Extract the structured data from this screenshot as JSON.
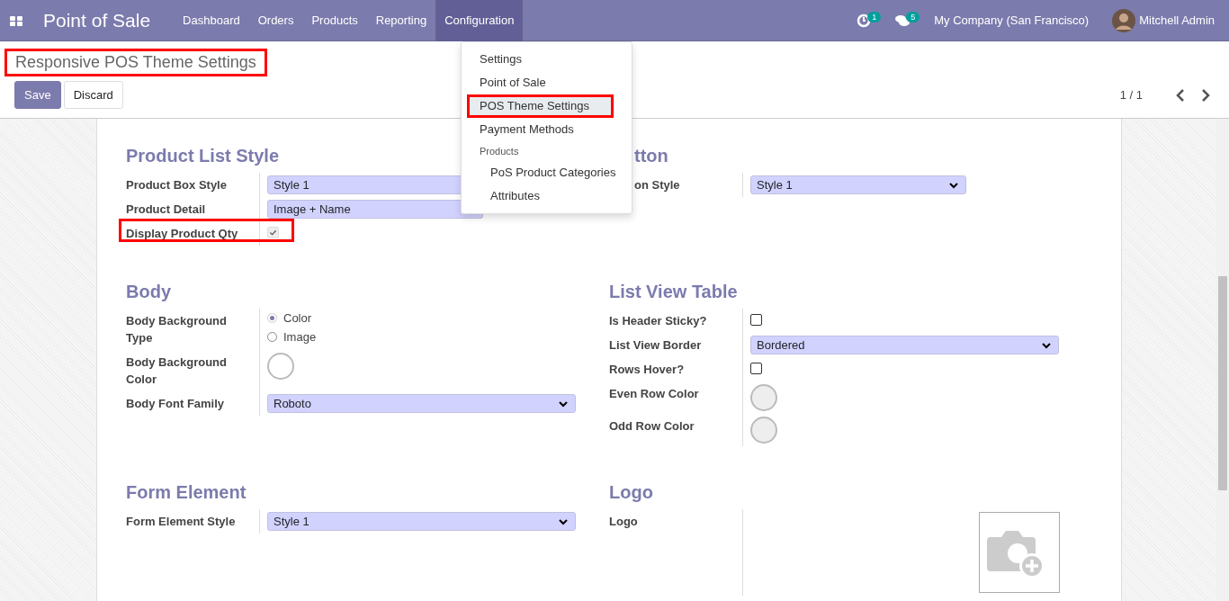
{
  "navbar": {
    "app_title": "Point of Sale",
    "menu": [
      {
        "label": "Dashboard",
        "selected": false
      },
      {
        "label": "Orders",
        "selected": false
      },
      {
        "label": "Products",
        "selected": false
      },
      {
        "label": "Reporting",
        "selected": false
      },
      {
        "label": "Configuration",
        "selected": true
      }
    ],
    "activity_count": "1",
    "message_count": "5",
    "company": "My Company (San Francisco)",
    "user": "Mitchell Admin"
  },
  "control_panel": {
    "title": "Responsive POS Theme Settings",
    "title_highlighted": true,
    "buttons": [
      {
        "label": "Save",
        "kind": "primary"
      },
      {
        "label": "Discard",
        "kind": "secondary"
      }
    ],
    "pager": "1 / 1"
  },
  "dropdown": {
    "items": [
      {
        "label": "Settings",
        "kind": "item",
        "selected": false,
        "highlighted": false
      },
      {
        "label": "Point of Sale",
        "kind": "item",
        "selected": false,
        "highlighted": false
      },
      {
        "label": "POS Theme Settings",
        "kind": "item",
        "selected": true,
        "highlighted": true
      },
      {
        "label": "Payment Methods",
        "kind": "item",
        "selected": false,
        "highlighted": false
      },
      {
        "label": "Products",
        "kind": "header"
      },
      {
        "label": "PoS Product Categories",
        "kind": "subitem",
        "selected": false,
        "highlighted": false
      },
      {
        "label": "Attributes",
        "kind": "subitem",
        "selected": false,
        "highlighted": false
      }
    ]
  },
  "sections": [
    {
      "title": "Product List Style",
      "covered": false,
      "fields": [
        {
          "label": "Product Box Style",
          "kind": "select",
          "value": "Style 1",
          "wide": false
        },
        {
          "label": "Product Detail",
          "kind": "select",
          "value": "Image + Name",
          "wide": false
        },
        {
          "label": "Display Product Qty",
          "kind": "checkbox",
          "checked": true,
          "highlighted": true
        }
      ]
    },
    {
      "title": "tton",
      "covered": true,
      "fields": [
        {
          "label": "on Style",
          "kind": "select",
          "value": "Style 1",
          "wide": false
        }
      ]
    },
    {
      "title": "Body",
      "covered": false,
      "fields": [
        {
          "label": "Body Background Type",
          "kind": "radio",
          "options": [
            {
              "label": "Color",
              "selected": true
            },
            {
              "label": "Image",
              "selected": false
            }
          ]
        },
        {
          "label": "Body Background Color",
          "kind": "color",
          "color": "#ffffff"
        },
        {
          "label": "Body Font Family",
          "kind": "select",
          "value": "Roboto",
          "wide": true
        }
      ]
    },
    {
      "title": "List View Table",
      "covered": false,
      "fields": [
        {
          "label": "Is Header Sticky?",
          "kind": "checkbox",
          "checked": false,
          "highlighted": false
        },
        {
          "label": "List View Border",
          "kind": "select",
          "value": "Bordered",
          "wide": true
        },
        {
          "label": "Rows Hover?",
          "kind": "checkbox",
          "checked": false,
          "highlighted": false
        },
        {
          "label": "Even Row Color",
          "kind": "color",
          "color": "#eeeeee"
        },
        {
          "label": "Odd Row Color",
          "kind": "color",
          "color": "#eeeeee"
        }
      ]
    },
    {
      "title": "Form Element",
      "covered": false,
      "fields": [
        {
          "label": "Form Element Style",
          "kind": "select",
          "value": "Style 1",
          "wide": true
        }
      ]
    },
    {
      "title": "Logo",
      "covered": false,
      "fields": [
        {
          "label": "Logo",
          "kind": "image"
        }
      ]
    }
  ]
}
